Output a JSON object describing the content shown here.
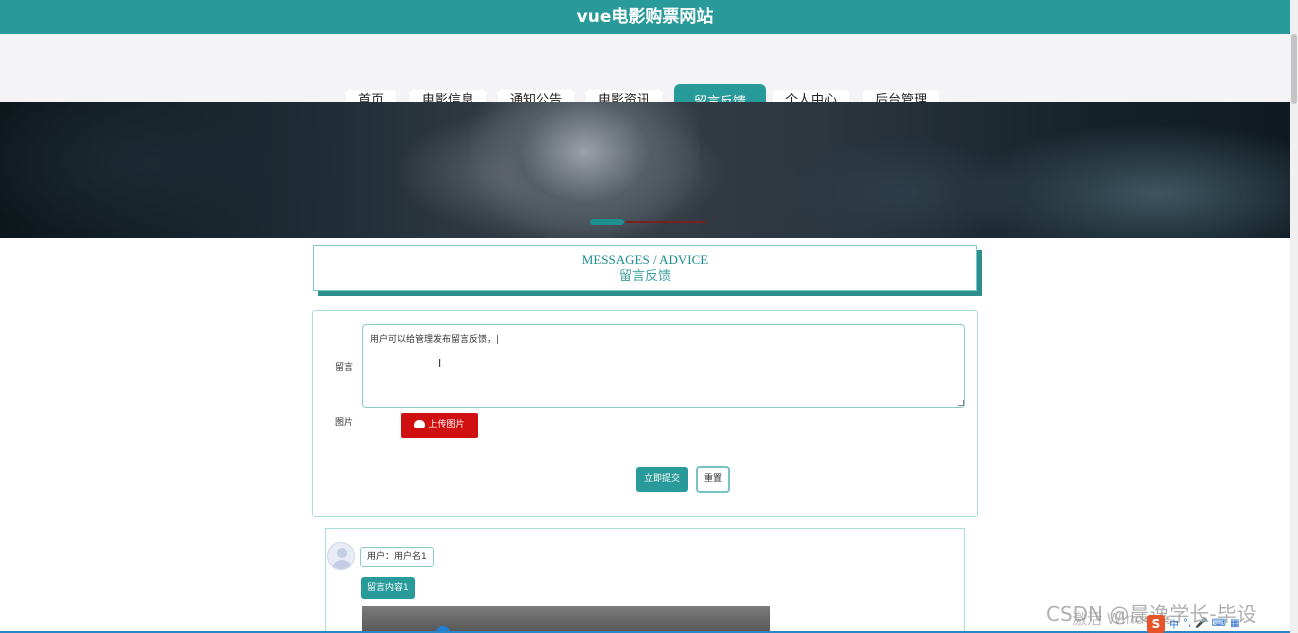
{
  "site": {
    "title": "vue电影购票网站"
  },
  "nav": {
    "items": [
      {
        "label": "首页",
        "active": false
      },
      {
        "label": "电影信息",
        "active": false
      },
      {
        "label": "通知公告",
        "active": false
      },
      {
        "label": "电影资讯",
        "active": false
      },
      {
        "label": "留言反馈",
        "active": true
      },
      {
        "label": "个人中心",
        "active": false
      },
      {
        "label": "后台管理",
        "active": false
      }
    ]
  },
  "banner": {
    "icon": "movie-banner-image"
  },
  "section": {
    "title_en": "MESSAGES / ADVICE",
    "title_cn": "留言反馈"
  },
  "form": {
    "message_label": "留言",
    "message_value": "用户可以给管理发布留言反馈，|",
    "image_label": "图片",
    "upload_label": "上传图片",
    "submit_label": "立即提交",
    "reset_label": "重置"
  },
  "messages": [
    {
      "user": "用户：用户名1",
      "content": "留言内容1"
    }
  ],
  "watermark": {
    "text": "CSDN @晨逸学长-毕设",
    "text2": "激活 Windows"
  },
  "ime": {
    "logo": "S",
    "mode": "中",
    "punct": "°,",
    "mic": "🎤",
    "keyboard": "⌨",
    "grid": "▦"
  },
  "colors": {
    "accent": "#289a9a",
    "upload": "#d01010"
  }
}
